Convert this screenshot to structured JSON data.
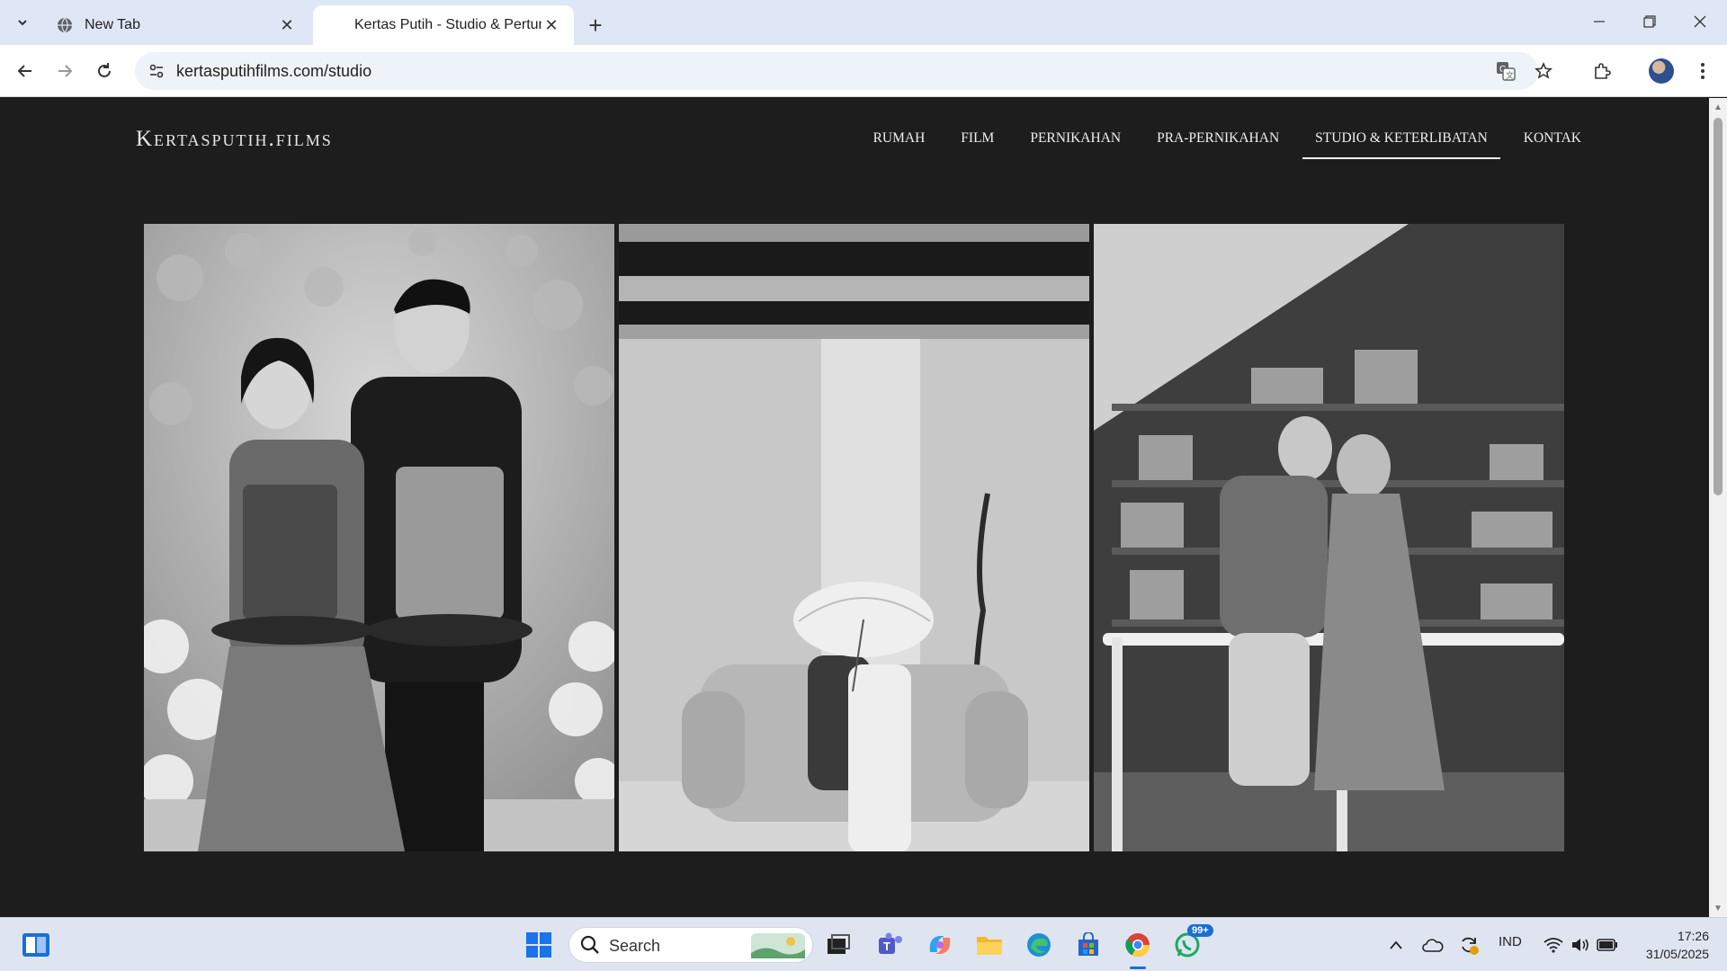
{
  "browser": {
    "tabs": [
      {
        "title": "New Tab",
        "active": false
      },
      {
        "title": "Kertas Putih - Studio & Pertunangan",
        "active": true
      }
    ],
    "url": "kertasputihfilms.com/studio"
  },
  "site": {
    "logo": "Kertasputih.films",
    "nav": [
      {
        "label": "RUMAH",
        "active": false
      },
      {
        "label": "FILM",
        "active": false
      },
      {
        "label": "PERNIKAHAN",
        "active": false
      },
      {
        "label": "PRA-PERNIKAHAN",
        "active": false
      },
      {
        "label": "STUDIO & KETERLIBATAN",
        "active": true
      },
      {
        "label": "KONTAK",
        "active": false
      }
    ]
  },
  "taskbar": {
    "search_label": "Search",
    "whatsapp_badge": "99+",
    "language": "IND",
    "time": "17:26",
    "date": "31/05/2025"
  },
  "colors": {
    "page_bg": "#1d1d1d",
    "accent_blue": "#1a6fd6"
  }
}
